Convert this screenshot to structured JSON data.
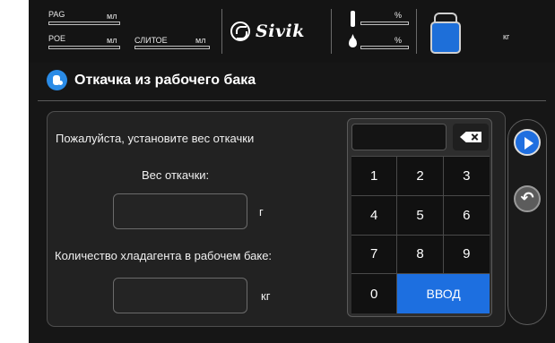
{
  "status": {
    "pag_label": "PAG",
    "pag_unit": "мл",
    "poe_label": "POE",
    "poe_unit": "мл",
    "drain_label": "СЛИТОЕ",
    "drain_unit": "мл",
    "brand": "Sivik",
    "pct_top": "%",
    "pct_bottom": "%",
    "tank_unit": "кг",
    "tank_color": "#1e6fd9"
  },
  "header": {
    "title": "Откачка из рабочего бака",
    "accent": "#2a8be6"
  },
  "form": {
    "prompt": "Пожалуйста, установите вес откачки",
    "weight_label": "Вес откачки:",
    "weight_value": "",
    "weight_unit": "г",
    "refrigerant_label": "Количество хладагента в рабочем баке:",
    "refrigerant_value": "",
    "refrigerant_unit": "кг"
  },
  "keypad": {
    "display": "",
    "keys": [
      "1",
      "2",
      "3",
      "4",
      "5",
      "6",
      "7",
      "8",
      "9",
      "0"
    ],
    "enter_label": "ВВОД",
    "enter_color": "#1d6fe0"
  },
  "nav": {
    "next_icon": "play-icon",
    "back_icon": "undo-icon"
  }
}
